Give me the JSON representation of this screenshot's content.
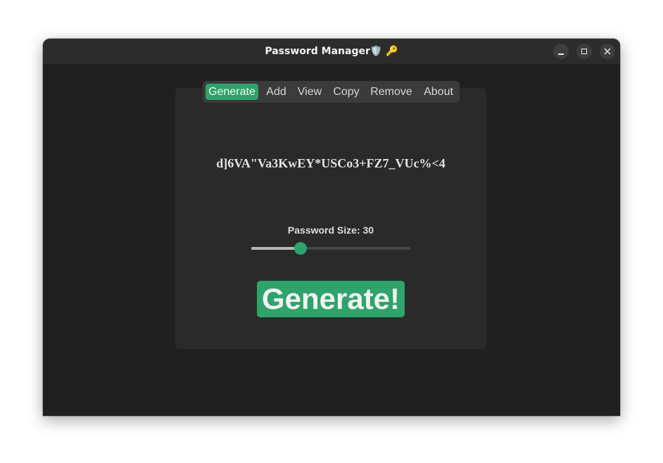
{
  "window": {
    "title": "Password Manager",
    "title_emoji_shield": "🛡️",
    "title_emoji_key": "🔑"
  },
  "tabs": [
    {
      "label": "Generate",
      "active": true
    },
    {
      "label": "Add",
      "active": false
    },
    {
      "label": "View",
      "active": false
    },
    {
      "label": "Copy",
      "active": false
    },
    {
      "label": "Remove",
      "active": false
    },
    {
      "label": "About",
      "active": false
    }
  ],
  "generator": {
    "password": "d]6VA\"Va3KwEY*USCo3+FZ7_VUc%<4",
    "size_label": "Password Size: 30",
    "slider_fraction": 0.31,
    "button_label": "Generate!"
  },
  "colors": {
    "accent": "#2ea36c",
    "window_bg": "#202020",
    "panel_bg": "#2a2a2a"
  },
  "icons": {
    "minimize": "minimize-icon",
    "maximize": "maximize-icon",
    "close": "close-icon"
  }
}
